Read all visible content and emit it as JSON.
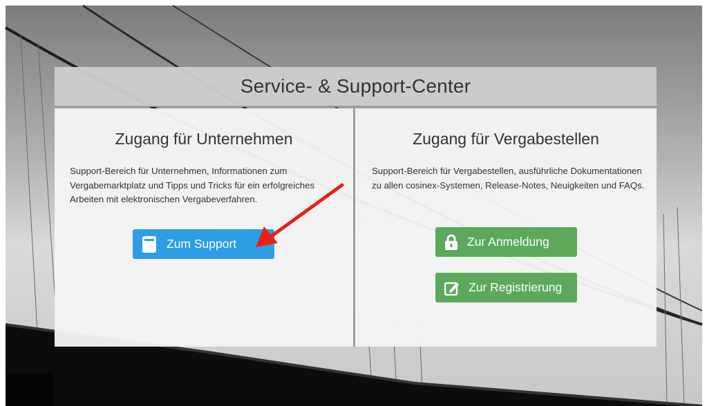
{
  "header": {
    "title": "Service- & Support-Center"
  },
  "left": {
    "heading": "Zugang für Unternehmen",
    "description": "Support-Bereich für Unternehmen, Informationen zum Vergabemarktplatz und Tipps und Tricks für ein erfolgreiches Arbeiten mit elektronischen Vergabeverfahren.",
    "button": {
      "label": "Zum Support",
      "icon": "book-icon",
      "color": "#2d9de5"
    }
  },
  "right": {
    "heading": "Zugang für Vergabestellen",
    "description": "Support-Bereich für Vergabestellen, ausführliche Dokumentationen zu allen cosinex-Systemen, Release-Notes, Neuigkeiten und FAQs.",
    "login_button": {
      "label": "Zur Anmeldung",
      "icon": "lock-icon",
      "color": "#5ca95c"
    },
    "register_button": {
      "label": "Zur Registrierung",
      "icon": "edit-icon",
      "color": "#5ca95c"
    }
  },
  "annotation": {
    "arrow_color": "#e8201a"
  }
}
